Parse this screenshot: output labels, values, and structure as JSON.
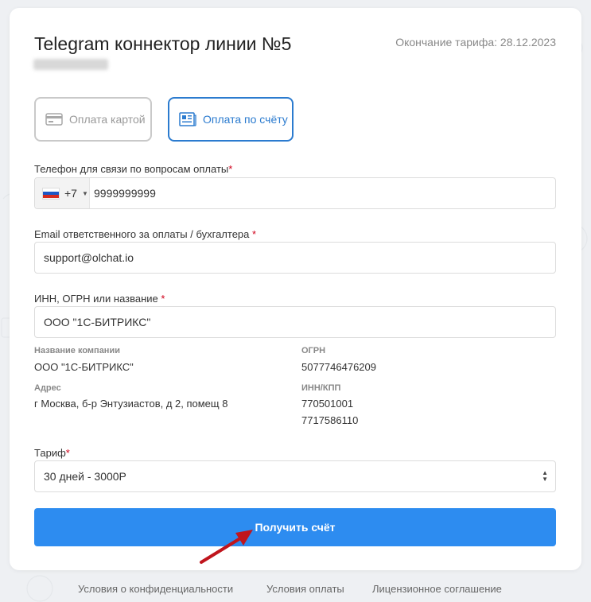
{
  "header": {
    "title": "Telegram коннектор линии №5",
    "expiry_label": "Окончание тарифа:",
    "expiry_date": "28.12.2023"
  },
  "payment_methods": [
    {
      "label": "Оплата картой",
      "icon": "credit-card-icon",
      "selected": false
    },
    {
      "label": "Оплата по счёту",
      "icon": "invoice-icon",
      "selected": true
    }
  ],
  "form": {
    "phone": {
      "label": "Телефон для связи по вопросам оплаты",
      "required_mark": "*",
      "country_code": "+7",
      "value": "9999999999"
    },
    "email": {
      "label": "Email ответственного за оплаты / бухгалтера",
      "required_mark": "*",
      "value": "support@olchat.io"
    },
    "company": {
      "label": "ИНН, ОГРН или название",
      "required_mark": "*",
      "value": "ООО \"1С-БИТРИКС\""
    },
    "tariff": {
      "label": "Тариф",
      "required_mark": "*",
      "value": "30 дней - 3000Р"
    }
  },
  "company_info": {
    "name_label": "Название компании",
    "name_value": "ООО \"1С-БИТРИКС\"",
    "ogrn_label": "ОГРН",
    "ogrn_value": "5077746476209",
    "address_label": "Адрес",
    "address_value": "г Москва, б-р Энтузиастов, д 2, помещ 8",
    "inn_kpp_label": "ИНН/КПП",
    "inn_value": "770501001",
    "kpp_value": "7717586110"
  },
  "submit_label": "Получить счёт",
  "footer": {
    "links": [
      "Условия о конфиденциальности",
      "Условия оплаты",
      "Лицензионное соглашение"
    ]
  },
  "colors": {
    "accent": "#2d8cf0",
    "selected_border": "#2b7bcf",
    "required": "#d0021b",
    "annotation_arrow": "#c0151d"
  }
}
